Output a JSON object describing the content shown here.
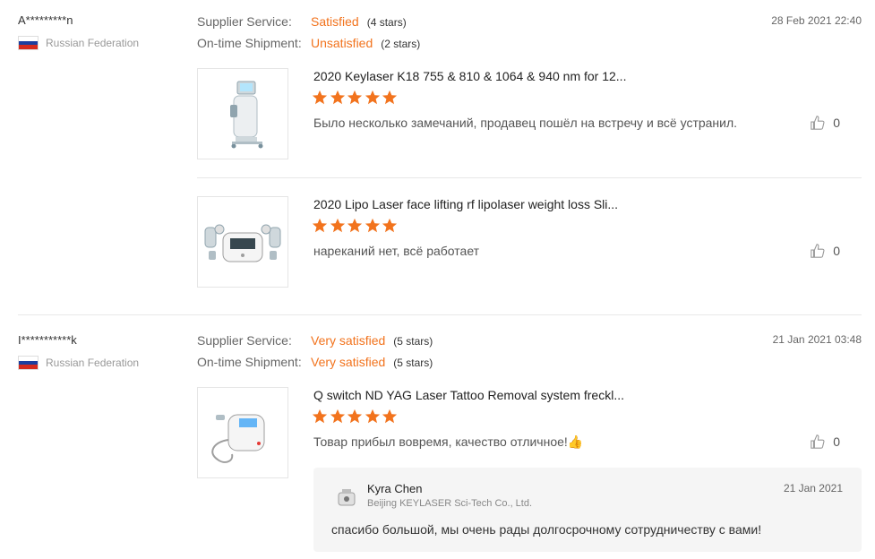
{
  "reviews": [
    {
      "buyer": "A*********n",
      "country": "Russian Federation",
      "date": "28 Feb 2021 22:40",
      "supplier_label": "Supplier Service:",
      "supplier_value": "Satisfied",
      "supplier_stars": "(4 stars)",
      "shipment_label": "On-time Shipment:",
      "shipment_value": "Unsatisfied",
      "shipment_stars": "(2 stars)",
      "items": [
        {
          "title": "2020 Keylaser K18 755 & 810 & 1064 & 940 nm for 12...",
          "rating": 5,
          "feedback": "Было несколько замечаний, продавец пошёл на встречу и всё устранил.",
          "likes": "0"
        },
        {
          "title": "2020 Lipo Laser face lifting rf lipolaser weight loss Sli...",
          "rating": 5,
          "feedback": "нареканий нет, всё работает",
          "likes": "0"
        }
      ]
    },
    {
      "buyer": "I***********k",
      "country": "Russian Federation",
      "date": "21 Jan 2021 03:48",
      "supplier_label": "Supplier Service:",
      "supplier_value": "Very satisfied",
      "supplier_stars": "(5 stars)",
      "shipment_label": "On-time Shipment:",
      "shipment_value": "Very satisfied",
      "shipment_stars": "(5 stars)",
      "items": [
        {
          "title": "Q switch ND YAG Laser Tattoo Removal system freckl...",
          "rating": 5,
          "feedback": "Товар прибыл вовремя, качество отличное!👍",
          "likes": "0"
        }
      ],
      "reply": {
        "name": "Kyra Chen",
        "company": "Beijing KEYLASER Sci-Tech Co., Ltd.",
        "date": "21 Jan 2021",
        "text": "спасибо большой, мы очень рады долгосрочному сотрудничеству с вами!"
      }
    }
  ],
  "colors": {
    "accent": "#f2731d",
    "star": "#f2731d",
    "flag_white": "#ffffff",
    "flag_blue": "#1c3fa0",
    "flag_red": "#d52b1e"
  }
}
